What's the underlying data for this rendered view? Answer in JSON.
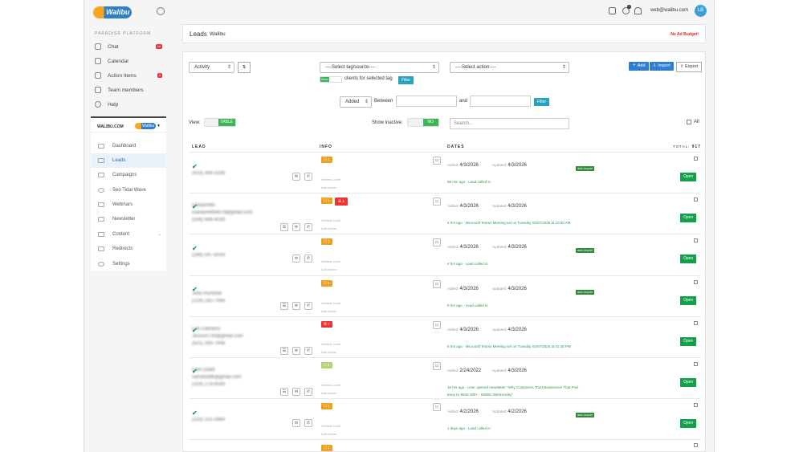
{
  "brand": {
    "logo_text": "Walibu"
  },
  "sidebar": {
    "section_label": "PARADISE PLATFORM",
    "items": [
      {
        "label": "Chat",
        "badge": "on"
      },
      {
        "label": "Calendar",
        "badge": ""
      },
      {
        "label": "Action Items",
        "badge": "8"
      },
      {
        "label": "Team members",
        "badge": ""
      },
      {
        "label": "Help",
        "badge": ""
      }
    ],
    "subnav": {
      "brand": "WALIBU.COM",
      "logo_text": "Walibu",
      "items": [
        {
          "label": "Dashboard",
          "active": false
        },
        {
          "label": "Leads",
          "active": true
        },
        {
          "label": "Campaigns",
          "active": false
        },
        {
          "label": "Seo Tidal Wave",
          "active": false
        },
        {
          "label": "Webinars",
          "active": false
        },
        {
          "label": "Newsletter",
          "active": false
        },
        {
          "label": "Content",
          "active": false,
          "chevron": "⌄"
        },
        {
          "label": "Redirects",
          "active": false
        },
        {
          "label": "Settings",
          "active": false
        }
      ]
    }
  },
  "topbar": {
    "email": "web@walibu.com",
    "avatar_initials": "LB",
    "notifications_count": "1",
    "icons": [
      "fullscreen-icon",
      "notifications-icon",
      "bell-icon"
    ]
  },
  "header": {
    "title": "Leads",
    "subtitle": "Walibu",
    "budget_warning": "No Ad Budget!"
  },
  "filters": {
    "activity": "Activity",
    "tag_source": "----Select tag/source----",
    "action": "----Select action----",
    "show_toggle": "Show",
    "clients_for_tag": "clients for selected tag",
    "filter_label": "Filter",
    "date_field": "Added",
    "between_label": "Between",
    "and_label": "and",
    "view_label": "View:",
    "view_toggle": "TABLE",
    "show_inactive_label": "Show inactive:",
    "show_inactive_toggle": "NO",
    "search_placeholder": "Search...",
    "all_label": "All",
    "add_label": "Add",
    "import_label": "Import",
    "export_label": "Export"
  },
  "table": {
    "headers": {
      "lead": "LEAD",
      "info": "INFO",
      "dates": "DATES",
      "total_label": "TOTAL:",
      "total_value": "917"
    },
    "added_label": "Added:",
    "updated_label": "Updated:",
    "interest_label": "Interest Level",
    "add_action_label": "Add Action",
    "open_label": "Open",
    "auto_import_label": "auto import",
    "rows": [
      {
        "lines": [
          "(414) 364-3338"
        ],
        "tags": [
          {
            "text": "☐ 1",
            "color": "y"
          }
        ],
        "added": "4/3/2026",
        "updated": "4/3/2026",
        "event": "58 min ago - Lead called in",
        "auto": true
      },
      {
        "lines": [
          "Danasmith",
          "Danasmith4879@gmail.com",
          "(508) 946-4039"
        ],
        "tags": [
          {
            "text": "☐ 1",
            "color": "y"
          },
          {
            "text": "☒ 1",
            "color": "r"
          }
        ],
        "added": "4/3/2026",
        "updated": "4/3/2026",
        "event": "4 hrs ago - Microsoft Teams Meeting set on Tuesday 04/07/2026 at 10:00 AM",
        "auto": false
      },
      {
        "lines": [
          "(268) 547-9039"
        ],
        "tags": [
          {
            "text": "☐ 1",
            "color": "y"
          }
        ],
        "added": "4/3/2026",
        "updated": "4/3/2026",
        "event": "4 hrs ago - Lead called in",
        "auto": true
      },
      {
        "lines": [
          "John Hummel",
          "(219) 242-7448"
        ],
        "tags": [
          {
            "text": "☐ 1",
            "color": "y"
          }
        ],
        "added": "4/3/2026",
        "updated": "4/3/2026",
        "event": "5 hrs ago - Lead called in",
        "auto": true
      },
      {
        "lines": [
          "Lee Clemens",
          "Jlusson739@gmail.com",
          "(501) 264-7948"
        ],
        "tags": [
          {
            "text": "☒ 1",
            "color": "r"
          }
        ],
        "added": "4/3/2026",
        "updated": "4/3/2026",
        "event": "5 hrs ago - Microsoft Teams Meeting set on Tuesday 04/07/2026 at 01:30 PM",
        "auto": false
      },
      {
        "lines": [
          "Sam Dodd",
          "samdodd6@gmail.com",
          "(319) 278-6599"
        ],
        "tags": [
          {
            "text": "☐ 1",
            "color": "g"
          }
        ],
        "added": "2/24/2022",
        "updated": "4/3/2026",
        "event": "15 hrs ago - User opened newsletter \"Why Customers Trust Businesses That Feel Easy to Work With – Walibu Wednesday\"",
        "auto": false
      },
      {
        "lines": [
          "(316) 251-0984"
        ],
        "tags": [
          {
            "text": "☐ 1",
            "color": "y"
          }
        ],
        "added": "4/2/2026",
        "updated": "4/2/2026",
        "event": "1 days ago - Lead called in",
        "auto": true
      }
    ]
  }
}
